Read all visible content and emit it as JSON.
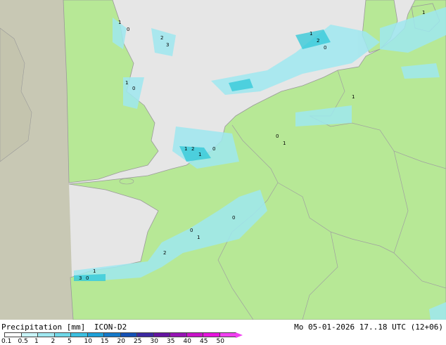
{
  "map": {
    "colors": {
      "sea": "#e6e6e6",
      "land_forecast": "#b7e896",
      "land_outside": "#c8c8b4",
      "coast": "#9a9a9a",
      "border": "#a0a0a0",
      "rain_light": "#9fe8f0",
      "rain_medium": "#2ec8d8"
    },
    "labels_note": "",
    "precip_values": [
      "1",
      "0",
      "2",
      "3",
      "1",
      "0",
      "1",
      "2",
      "1",
      "0",
      "0",
      "1",
      "1",
      "2",
      "0",
      "1",
      "3",
      "0",
      "1",
      "0",
      "1",
      "0",
      "2",
      "1"
    ]
  },
  "footer": {
    "title": "Precipitation [mm]",
    "model": "ICON-D2",
    "valid_time": "Mo 05-01-2026 17..18 UTC (12+06)",
    "scale_ticks": [
      "0.1",
      "0.5",
      "1",
      "2",
      "5",
      "10",
      "15",
      "20",
      "25",
      "30",
      "35",
      "40",
      "45",
      "50"
    ],
    "scale_colors": [
      "#fefefe",
      "#c8f4f8",
      "#a0e8f0",
      "#6fd8e8",
      "#3cc0e0",
      "#1ea0d8",
      "#1478c8",
      "#1450b4",
      "#3c28a0",
      "#6414a0",
      "#9614b4",
      "#c814c8",
      "#e614dc",
      "#f040f0"
    ]
  }
}
